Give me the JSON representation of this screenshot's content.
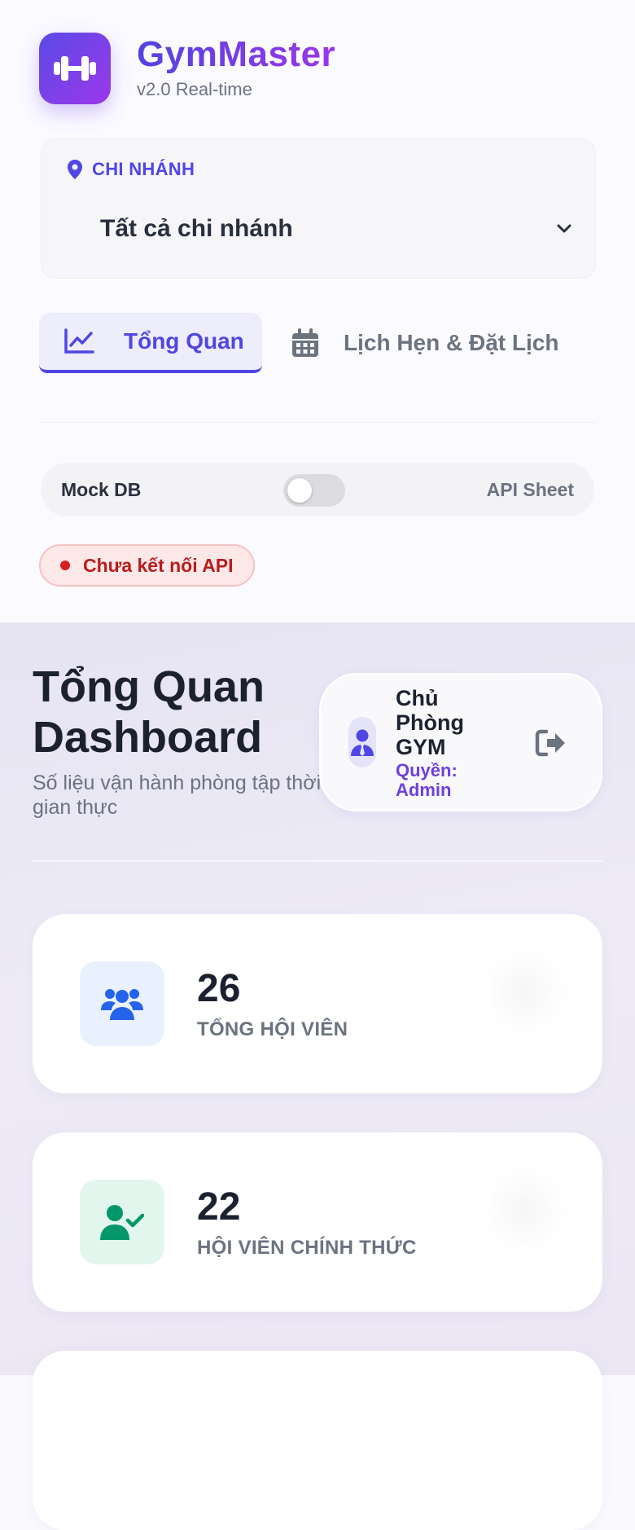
{
  "brand": {
    "title": "GymMaster",
    "subtitle": "v2.0 Real-time"
  },
  "branch": {
    "label": "CHI NHÁNH",
    "selected": "Tất cả chi nhánh"
  },
  "tabs": [
    {
      "label": "Tổng Quan",
      "active": true
    },
    {
      "label": "Lịch Hẹn & Đặt Lịch",
      "active": false
    }
  ],
  "data_source": {
    "left_label": "Mock DB",
    "right_label": "API Sheet",
    "api_enabled": false
  },
  "status": {
    "text": "Chưa kết nối API",
    "color": "#d42020"
  },
  "header": {
    "title": "Tổng Quan Dashboard",
    "subtitle": "Số liệu vận hành phòng tập thời gian thực"
  },
  "user": {
    "name": "Chủ Phòng GYM",
    "role": "Quyền: Admin"
  },
  "stats": [
    {
      "value": "26",
      "label": "TỔNG HỘI VIÊN",
      "icon": "users-icon",
      "color": "#2563eb"
    },
    {
      "value": "22",
      "label": "HỘI VIÊN CHÍNH THỨC",
      "icon": "user-check-icon",
      "color": "#059669"
    }
  ],
  "colors": {
    "accent": "#4f46e5",
    "brand_gradient_end": "#9b38ea"
  }
}
